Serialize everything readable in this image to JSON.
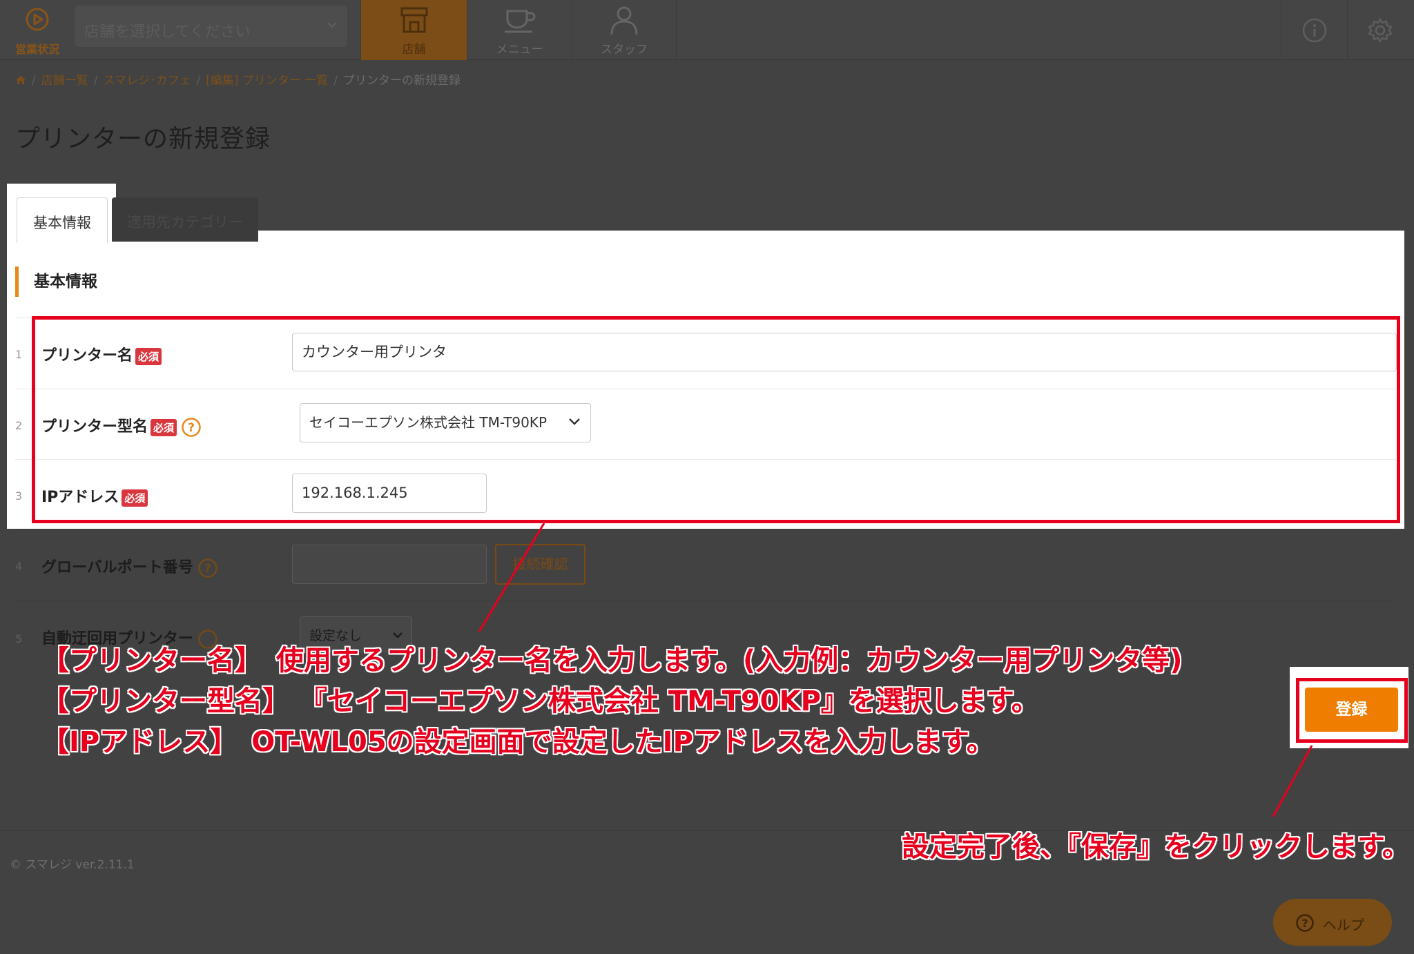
{
  "nav": {
    "status_label": "営業状況",
    "store_placeholder": "店舗を選択してください",
    "tabs": [
      {
        "label": "店舗",
        "icon": "store-icon"
      },
      {
        "label": "メニュー",
        "icon": "menu-icon"
      },
      {
        "label": "スタッフ",
        "icon": "staff-icon"
      }
    ],
    "info_icon": "info-icon",
    "settings_icon": "gear-icon"
  },
  "breadcrumb": {
    "home_icon": "home-icon",
    "items": [
      "店舗一覧",
      "スマレジ･カフェ",
      "[編集] プリンター 一覧",
      "プリンターの新規登録"
    ]
  },
  "page_title": "プリンターの新規登録",
  "tabs": [
    "基本情報",
    "適用先カテゴリー"
  ],
  "section_title": "基本情報",
  "required_badge": "必須",
  "form": {
    "printer_name": {
      "num": "1",
      "label": "プリンター名",
      "value": "カウンター用プリンタ"
    },
    "printer_model": {
      "num": "2",
      "label": "プリンター型名",
      "value": "セイコーエプソン株式会社 TM-T90KP"
    },
    "ip_address": {
      "num": "3",
      "label": "IPアドレス",
      "value": "192.168.1.245"
    },
    "global_port": {
      "num": "4",
      "label": "グローバルポート番号",
      "value": "",
      "button": "接続確認"
    },
    "auto_print": {
      "num": "5",
      "label": "自動迂回用プリンター",
      "value": "設定なし"
    }
  },
  "annotation": {
    "line1": "【プリンター名】　使用するプリンター名を入力します。(入力例：カウンター用プリンタ等)",
    "line2": "【プリンター型名】 『セイコーエプソン株式会社 TM-T90KP』を選択します。",
    "line3": "【IPアドレス】　OT-WL05の設定画面で設定したIPアドレスを入力します。",
    "save_note": "設定完了後、『保存』をクリックします。"
  },
  "register_button": "登録",
  "footer": {
    "copyright": "© スマレジ ver.2.11.1"
  },
  "help_button": "ヘルプ",
  "colors": {
    "accent": "#ee7d00",
    "annotation_red": "#e6001e",
    "required_red": "#d9363e",
    "overlay": "#424242"
  }
}
